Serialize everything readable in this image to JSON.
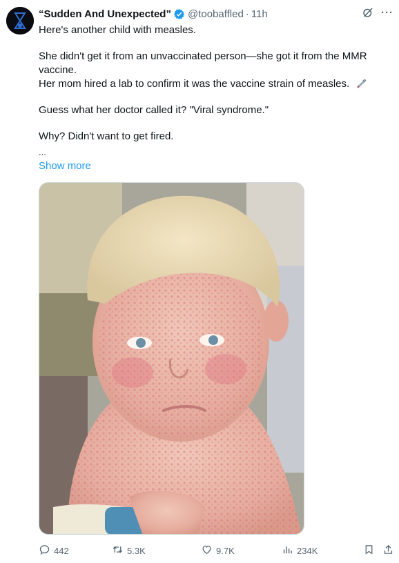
{
  "tweet": {
    "display_name": "“Sudden And Unexpected”",
    "handle": "@toobaffled",
    "separator": "·",
    "time": "11h",
    "more_label": "···",
    "lines": [
      "Here's another child with measles.",
      "She didn't get it from an unvaccinated person—she got it from the MMR vaccine.",
      "Her mom hired a lab to confirm it was the vaccine strain of measles.",
      "Guess what her doctor called it? \"Viral syndrome.\"",
      "Why? Didn't want to get fired."
    ],
    "ellipsis": "...",
    "show_more": "Show more",
    "media_alt": "photo of a toddler with a red rash"
  },
  "actions": {
    "replies": "442",
    "retweets": "5.3K",
    "likes": "9.7K",
    "views": "234K"
  },
  "colors": {
    "link": "#1d9bf0",
    "muted": "#536471",
    "verified": "#1d9bf0"
  },
  "icons": [
    "verified-badge-icon",
    "grok-icon",
    "more-icon",
    "syringe-icon",
    "reply-icon",
    "retweet-icon",
    "like-icon",
    "views-icon",
    "bookmark-icon",
    "share-icon"
  ]
}
